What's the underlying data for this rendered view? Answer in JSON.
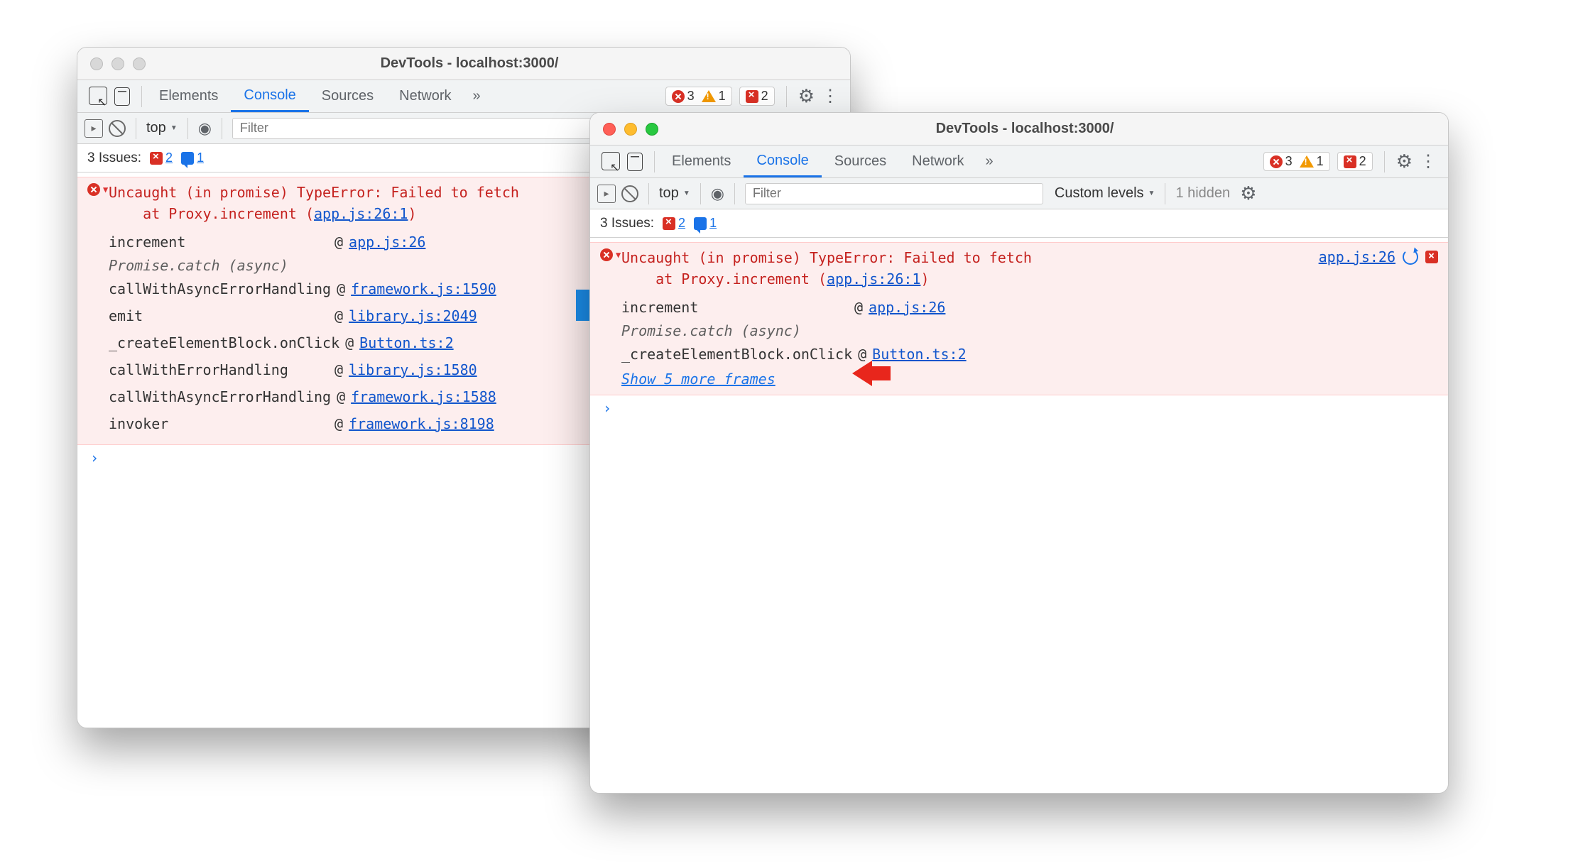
{
  "window1": {
    "title": "DevTools - localhost:3000/",
    "tabs": [
      "Elements",
      "Console",
      "Sources",
      "Network"
    ],
    "active_tab": 1,
    "counts": {
      "errors": "3",
      "warnings": "1",
      "flags": "2"
    },
    "toolbar": {
      "context": "top",
      "filter_placeholder": "Filter"
    },
    "issues": {
      "label": "3 Issues:",
      "flags": "2",
      "chats": "1"
    },
    "error": {
      "head": "Uncaught (in promise) TypeError: Failed to fetch",
      "at_prefix": "at Proxy.increment (",
      "at_link": "app.js:26:1",
      "at_suffix": ")",
      "trace": [
        {
          "fn": "increment",
          "loc": "app.js:26"
        }
      ],
      "async_label": "Promise.catch (async)",
      "trace2": [
        {
          "fn": "callWithAsyncErrorHandling",
          "loc": "framework.js:1590"
        },
        {
          "fn": "emit",
          "loc": "library.js:2049"
        },
        {
          "fn": "_createElementBlock.onClick",
          "loc": "Button.ts:2"
        },
        {
          "fn": "callWithErrorHandling",
          "loc": "library.js:1580"
        },
        {
          "fn": "callWithAsyncErrorHandling",
          "loc": "framework.js:1588"
        },
        {
          "fn": "invoker",
          "loc": "framework.js:8198"
        }
      ]
    }
  },
  "window2": {
    "title": "DevTools - localhost:3000/",
    "tabs": [
      "Elements",
      "Console",
      "Sources",
      "Network"
    ],
    "active_tab": 1,
    "counts": {
      "errors": "3",
      "warnings": "1",
      "flags": "2"
    },
    "toolbar": {
      "context": "top",
      "filter_placeholder": "Filter",
      "levels": "Custom levels",
      "hidden": "1 hidden"
    },
    "issues": {
      "label": "3 Issues:",
      "flags": "2",
      "chats": "1"
    },
    "error": {
      "head": "Uncaught (in promise) TypeError: Failed to fetch",
      "at_prefix": "at Proxy.increment (",
      "at_link": "app.js:26:1",
      "at_suffix": ")",
      "source_link": "app.js:26",
      "trace": [
        {
          "fn": "increment",
          "loc": "app.js:26"
        }
      ],
      "async_label": "Promise.catch (async)",
      "trace2": [
        {
          "fn": "_createElementBlock.onClick",
          "loc": "Button.ts:2"
        }
      ],
      "show_more": "Show 5 more frames"
    }
  }
}
